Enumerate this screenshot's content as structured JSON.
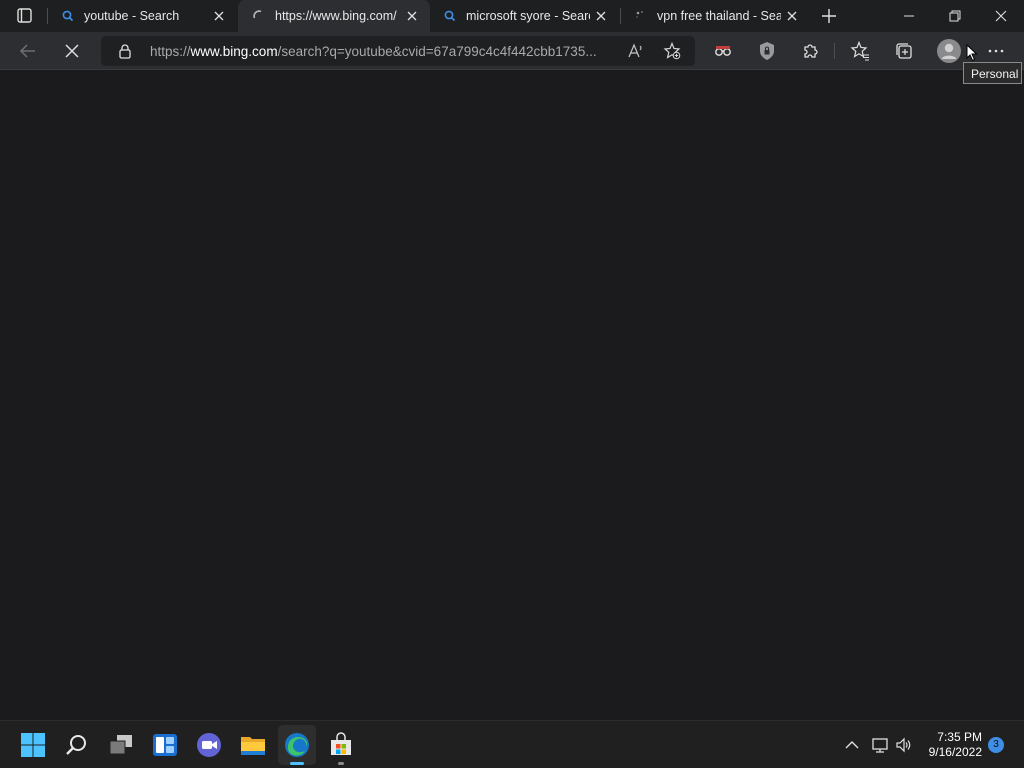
{
  "browser": {
    "tabs": [
      {
        "title": "youtube - Search",
        "icon": "search-icon",
        "active": false
      },
      {
        "title": "https://www.bing.com/search?q=youtube",
        "icon": "loading-icon",
        "active": true
      },
      {
        "title": "microsoft syore - Search",
        "icon": "search-icon",
        "active": false
      },
      {
        "title": "vpn free thailand - Search",
        "icon": "loading-icon",
        "active": false
      }
    ],
    "address": {
      "url_prefix": "https://",
      "url_host": "www.bing.com",
      "url_rest": "/search?q=youtube&cvid=67a799c4c4f442cbb1735..."
    },
    "profile_tooltip": "Personal"
  },
  "taskbar": {
    "apps": [
      "start-icon",
      "search-icon",
      "task-view-icon",
      "widgets-icon",
      "chat-icon",
      "file-explorer-icon",
      "edge-icon",
      "store-icon"
    ],
    "clock": {
      "time": "7:35 PM",
      "date": "9/16/2022"
    },
    "notification_count": "3"
  },
  "colors": {
    "accent": "#3e8ee6",
    "tab_active": "#2d2e31",
    "page_bg": "#1b1b1d"
  }
}
